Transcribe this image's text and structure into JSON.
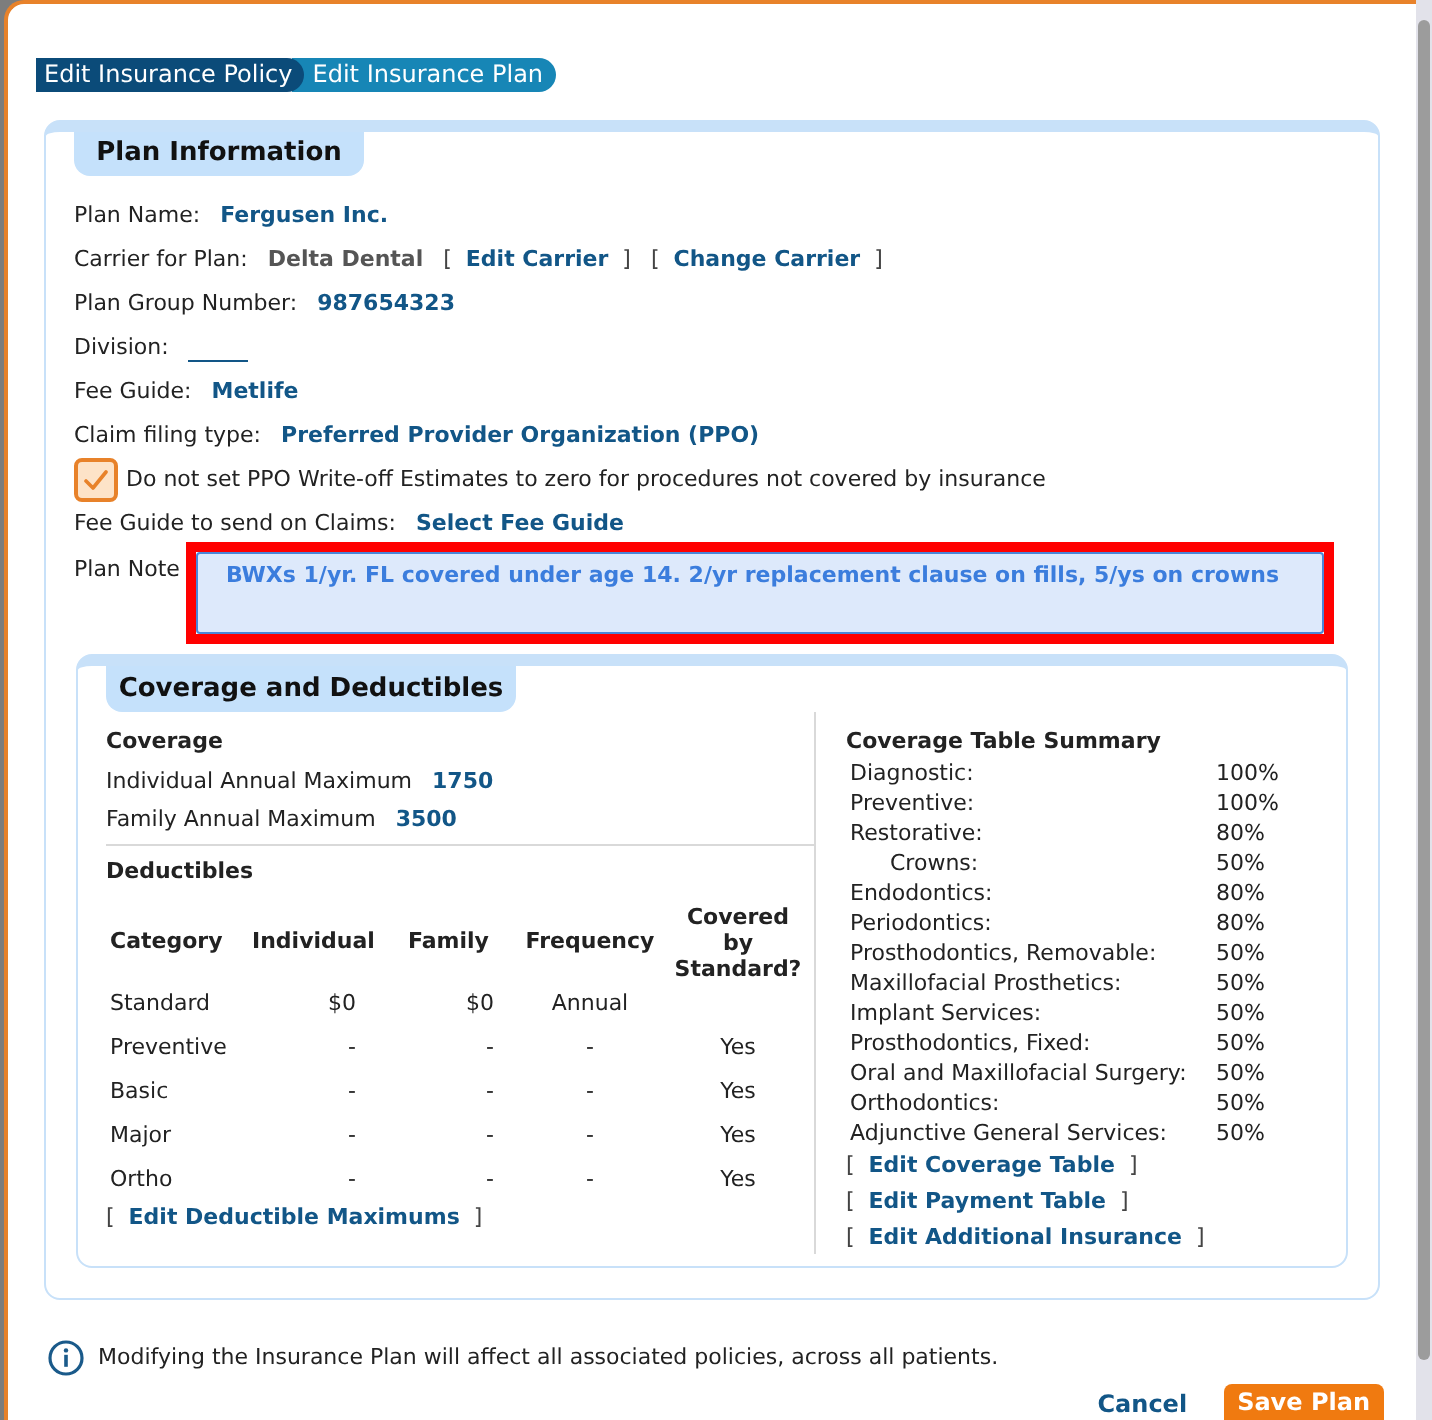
{
  "tabs": [
    {
      "label": "Edit Insurance Policy",
      "selected": false
    },
    {
      "label": "Edit Insurance Plan",
      "selected": true
    }
  ],
  "plan_information": {
    "title": "Plan Information",
    "fields": [
      {
        "kind": "value",
        "label": "Plan Name:",
        "value": "Fergusen Inc."
      },
      {
        "kind": "carrier",
        "label": "Carrier for Plan:",
        "value": "Delta Dental",
        "links": [
          {
            "before": "[",
            "label": "Edit Carrier",
            "after": "]"
          },
          {
            "before": "[",
            "label": "Change Carrier",
            "after": "]"
          }
        ]
      },
      {
        "kind": "value",
        "label": "Plan Group Number:",
        "value": "987654323"
      },
      {
        "kind": "blank",
        "label": "Division:"
      },
      {
        "kind": "value",
        "label": "Fee Guide:",
        "value": "Metlife"
      },
      {
        "kind": "value",
        "label": "Claim filing type:",
        "value": "Preferred Provider Organization (PPO)"
      },
      {
        "kind": "checkbox",
        "label": "Do not set PPO Write-off Estimates to zero for procedures not covered by insurance",
        "checked": true
      },
      {
        "kind": "link",
        "label": "Fee Guide to send on Claims:",
        "value": "Select Fee Guide"
      },
      {
        "kind": "note",
        "label": "Plan Note",
        "value": "BWXs 1/yr. FL covered under age 14. 2/yr replacement clause on fills, 5/ys on crowns",
        "highlighted": true
      }
    ]
  },
  "coverage_and_deductibles": {
    "title": "Coverage and Deductibles",
    "coverage": {
      "heading": "Coverage",
      "items": [
        {
          "label": "Individual Annual Maximum",
          "value": "1750"
        },
        {
          "label": "Family Annual Maximum",
          "value": "3500"
        }
      ]
    },
    "deductibles": {
      "heading": "Deductibles",
      "columns": [
        "Category",
        "Individual",
        "Family",
        "Frequency",
        "Covered by Standard?"
      ],
      "rows": [
        {
          "category": "Standard",
          "individual": "$0",
          "family": "$0",
          "frequency": "Annual"
        },
        {
          "category": "Preventive",
          "individual": "-",
          "family": "-",
          "frequency": "-",
          "covered": "Yes"
        },
        {
          "category": "Basic",
          "individual": "-",
          "family": "-",
          "frequency": "-",
          "covered": "Yes"
        },
        {
          "category": "Major",
          "individual": "-",
          "family": "-",
          "frequency": "-",
          "covered": "Yes"
        },
        {
          "category": "Ortho",
          "individual": "-",
          "family": "-",
          "frequency": "-",
          "covered": "Yes"
        }
      ],
      "link": {
        "before": "[",
        "label": "Edit Deductible Maximums",
        "after": "]"
      }
    },
    "summary": {
      "heading": "Coverage Table Summary",
      "items": [
        {
          "label": "Diagnostic:",
          "value": "100%"
        },
        {
          "label": "Preventive:",
          "value": "100%"
        },
        {
          "label": "Restorative:",
          "value": "80%",
          "children": [
            {
              "label": "Crowns:",
              "value": "50%"
            }
          ]
        },
        {
          "label": "Endodontics:",
          "value": "80%"
        },
        {
          "label": "Periodontics:",
          "value": "80%"
        },
        {
          "label": "Prosthodontics, Removable:",
          "value": "50%"
        },
        {
          "label": "Maxillofacial Prosthetics:",
          "value": "50%"
        },
        {
          "label": "Implant Services:",
          "value": "50%"
        },
        {
          "label": "Prosthodontics, Fixed:",
          "value": "50%"
        },
        {
          "label": "Oral and Maxillofacial Surgery:",
          "value": "50%"
        },
        {
          "label": "Orthodontics:",
          "value": "50%"
        },
        {
          "label": "Adjunctive General Services:",
          "value": "50%"
        }
      ],
      "links": [
        {
          "before": "[",
          "label": "Edit Coverage Table",
          "after": "]"
        },
        {
          "before": "[",
          "label": "Edit Payment Table",
          "after": "]"
        },
        {
          "before": "[",
          "label": "Edit Additional Insurance",
          "after": "]"
        }
      ]
    }
  },
  "footer": {
    "notice": "Modifying the Insurance Plan will affect all associated policies, across all patients.",
    "buttons": [
      {
        "kind": "link",
        "label": "Cancel"
      },
      {
        "kind": "primary",
        "label": "Save Plan"
      }
    ]
  }
}
